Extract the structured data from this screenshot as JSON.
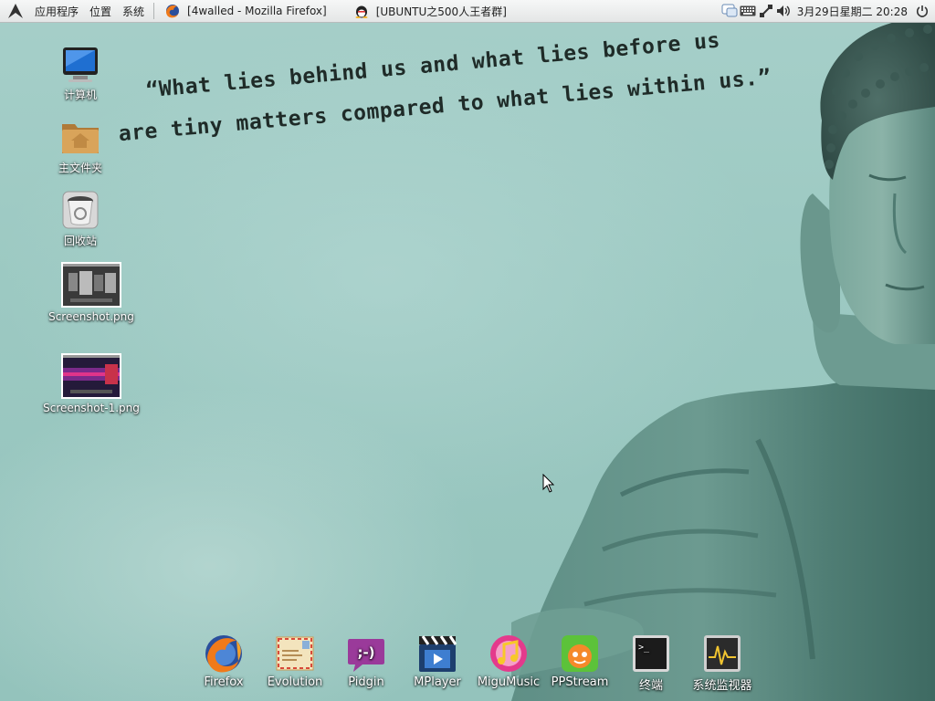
{
  "panel": {
    "menus": [
      {
        "label": "应用程序"
      },
      {
        "label": "位置"
      },
      {
        "label": "系统"
      }
    ],
    "tasks": [
      {
        "label": "[4walled - Mozilla Firefox]",
        "icon": "firefox-icon"
      },
      {
        "label": "[UBUNTU之500人王者群]",
        "icon": "qq-penguin-icon"
      }
    ],
    "tray": {
      "icons": [
        "chat-bubble-icon",
        "keyboard-icon",
        "network-icon",
        "volume-icon"
      ],
      "clock": "3月29日星期二 20:28",
      "power_icon": "power-icon"
    }
  },
  "wallpaper": {
    "quote_line1": "“What lies behind us and what lies before us",
    "quote_line2": "are tiny matters compared to what lies within us.”"
  },
  "desktop_icons": [
    {
      "label": "计算机",
      "icon": "computer-icon"
    },
    {
      "label": "主文件夹",
      "icon": "home-folder-icon"
    },
    {
      "label": "回收站",
      "icon": "trash-icon"
    },
    {
      "label": "Screenshot.png",
      "icon": "image-thumbnail-icon"
    },
    {
      "label": "Screenshot-1.png",
      "icon": "image-thumbnail-icon"
    }
  ],
  "dock": [
    {
      "label": "Firefox",
      "icon": "firefox-icon"
    },
    {
      "label": "Evolution",
      "icon": "mail-envelope-icon"
    },
    {
      "label": "Pidgin",
      "icon": "pidgin-icon"
    },
    {
      "label": "MPlayer",
      "icon": "clapperboard-icon"
    },
    {
      "label": "MiguMusic",
      "icon": "music-note-icon"
    },
    {
      "label": "PPStream",
      "icon": "ppstream-icon"
    },
    {
      "label": "终端",
      "icon": "terminal-icon"
    },
    {
      "label": "系统监视器",
      "icon": "system-monitor-icon"
    }
  ],
  "colors": {
    "wallpaper": "#9cc9c2",
    "panel": "#eceeee",
    "quote_text": "#1f2b28"
  }
}
